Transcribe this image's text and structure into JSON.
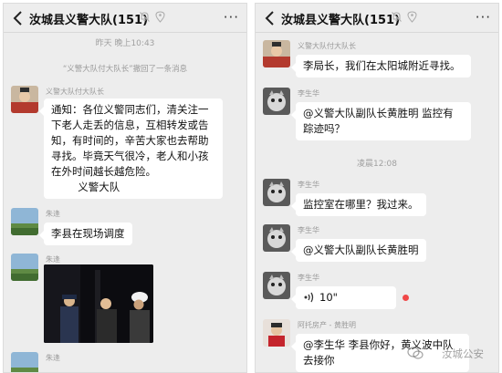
{
  "left": {
    "title": "汝城县义警大队(151)",
    "timestamp": "昨天 晚上10:43",
    "recall_notice": "“义警大队付大队长”撤回了一条消息",
    "messages": [
      {
        "sender": "义警大队付大队长",
        "text": "通知：各位义警同志们，清关注一下老人走丢的信息，互相转发或告知，有时间的，辛苦大家也去帮助寻找。毕竟天气很冷，老人和小孩在外时间越长越危险。\n        义警大队"
      },
      {
        "sender": "朱逢",
        "text": "李县在现场调度"
      },
      {
        "sender": "朱逢",
        "text": ""
      },
      {
        "sender": "朱逢",
        "text": ""
      }
    ]
  },
  "right": {
    "title": "汝城县义警大队(151)",
    "timestamp": "凌晨12:08",
    "messages": [
      {
        "sender": "义警大队付大队长",
        "text": "李局长，我们在太阳城附近寻找。"
      },
      {
        "sender": "李生华",
        "text": "@义警大队副队长黄胜明  监控有踪迹吗？"
      },
      {
        "sender": "李生华",
        "text": "监控室在哪里？我过来。"
      },
      {
        "sender": "李生华",
        "text": "@义警大队副队长黄胜明"
      },
      {
        "sender": "李生华",
        "text": "10\""
      },
      {
        "sender": "阿托房产 - 黄胜明",
        "text": "@李生华  李县你好，黄义波中队去接你"
      }
    ]
  },
  "watermark": "汝城公安",
  "icons": {
    "back": "chevron-left-icon",
    "mute": "bell-mute-icon",
    "location": "location-icon",
    "menu": "more-icon",
    "voice": "voice-wave-icon"
  },
  "colors": {
    "chat_bg": "#ededed",
    "bubble": "#ffffff",
    "unread_dot": "#f04848"
  }
}
